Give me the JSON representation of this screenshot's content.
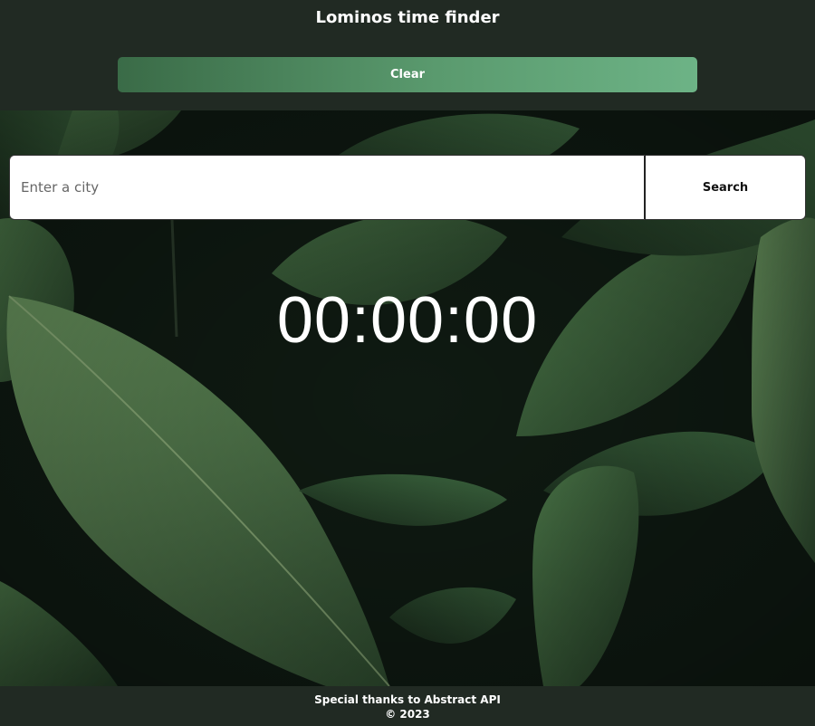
{
  "header": {
    "title": "Lominos time finder",
    "clear_label": "Clear"
  },
  "search": {
    "placeholder": "Enter a city",
    "value": "",
    "button_label": "Search"
  },
  "clock": {
    "time": "00:00:00"
  },
  "background": {
    "image": "leaf-foliage-photo"
  },
  "footer": {
    "credit": "Special thanks to Abstract API",
    "copyright": "© 2023"
  },
  "colors": {
    "header_bg": "#212a23",
    "accent_start": "#3a6b47",
    "accent_end": "#6db386",
    "text": "#ffffff"
  }
}
